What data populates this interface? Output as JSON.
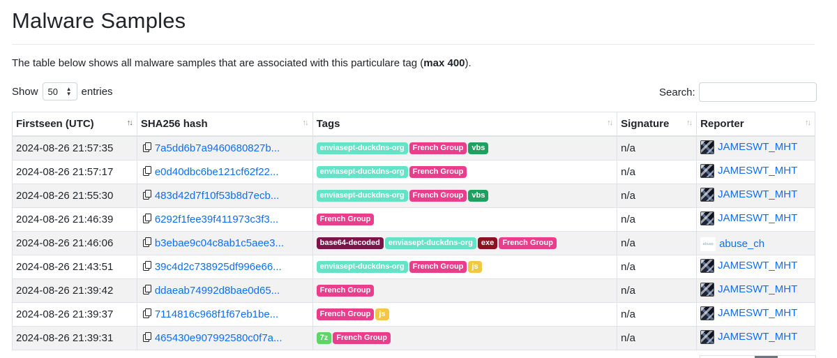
{
  "page": {
    "title": "Malware Samples",
    "intro_text": "The table below shows all malware samples that are associated with this particulare tag (",
    "intro_bold": "max 400",
    "intro_end": ")."
  },
  "length_menu": {
    "show_label": "Show",
    "selected": "50",
    "entries_label": "entries"
  },
  "search": {
    "label": "Search:",
    "value": ""
  },
  "table": {
    "columns": [
      "Firstseen (UTC)",
      "SHA256 hash",
      "Tags",
      "Signature",
      "Reporter"
    ],
    "rows": [
      {
        "firstseen": "2024-08-26 21:57:35",
        "hash": "7a5dd6b7a9460680827b...",
        "tags": [
          {
            "label": "enviasept-duckdns-org",
            "color": "#64e3c6"
          },
          {
            "label": "French Group",
            "color": "#e83e8c"
          },
          {
            "label": "vbs",
            "color": "#1fa05f"
          }
        ],
        "signature": "n/a",
        "reporter": "JAMESWT_MHT",
        "avatar": "photo"
      },
      {
        "firstseen": "2024-08-26 21:57:17",
        "hash": "e0d40dbc6be121cf62f22...",
        "tags": [
          {
            "label": "enviasept-duckdns-org",
            "color": "#64e3c6"
          },
          {
            "label": "French Group",
            "color": "#e83e8c"
          }
        ],
        "signature": "n/a",
        "reporter": "JAMESWT_MHT",
        "avatar": "photo"
      },
      {
        "firstseen": "2024-08-26 21:55:30",
        "hash": "483d42d7f10f53b8d7ecb...",
        "tags": [
          {
            "label": "enviasept-duckdns-org",
            "color": "#64e3c6"
          },
          {
            "label": "French Group",
            "color": "#e83e8c"
          },
          {
            "label": "vbs",
            "color": "#1fa05f"
          }
        ],
        "signature": "n/a",
        "reporter": "JAMESWT_MHT",
        "avatar": "photo"
      },
      {
        "firstseen": "2024-08-26 21:46:39",
        "hash": "6292f1fee39f411973c3f3...",
        "tags": [
          {
            "label": "French Group",
            "color": "#e83e8c"
          }
        ],
        "signature": "n/a",
        "reporter": "JAMESWT_MHT",
        "avatar": "photo"
      },
      {
        "firstseen": "2024-08-26 21:46:06",
        "hash": "b3ebae9c04c8ab1c5aee3...",
        "tags": [
          {
            "label": "base64-decoded",
            "color": "#7a1449"
          },
          {
            "label": "enviasept-duckdns-org",
            "color": "#64e3c6"
          },
          {
            "label": "exe",
            "color": "#8b1221"
          },
          {
            "label": "French Group",
            "color": "#e83e8c"
          }
        ],
        "signature": "n/a",
        "reporter": "abuse_ch",
        "avatar": "abuse"
      },
      {
        "firstseen": "2024-08-26 21:43:51",
        "hash": "39c4d2c738925df996e66...",
        "tags": [
          {
            "label": "enviasept-duckdns-org",
            "color": "#64e3c6"
          },
          {
            "label": "French Group",
            "color": "#e83e8c"
          },
          {
            "label": "js",
            "color": "#f2c744"
          }
        ],
        "signature": "n/a",
        "reporter": "JAMESWT_MHT",
        "avatar": "photo"
      },
      {
        "firstseen": "2024-08-26 21:39:42",
        "hash": "ddaeab74992d8bae0d65...",
        "tags": [
          {
            "label": "French Group",
            "color": "#e83e8c"
          }
        ],
        "signature": "n/a",
        "reporter": "JAMESWT_MHT",
        "avatar": "photo"
      },
      {
        "firstseen": "2024-08-26 21:39:37",
        "hash": "7114816c968f1f67eb1be...",
        "tags": [
          {
            "label": "French Group",
            "color": "#e83e8c"
          },
          {
            "label": "js",
            "color": "#f2c744"
          }
        ],
        "signature": "n/a",
        "reporter": "JAMESWT_MHT",
        "avatar": "photo"
      },
      {
        "firstseen": "2024-08-26 21:39:31",
        "hash": "465430e907992580c0f7a...",
        "tags": [
          {
            "label": "7z",
            "color": "#5fd46a"
          },
          {
            "label": "French Group",
            "color": "#e83e8c"
          }
        ],
        "signature": "n/a",
        "reporter": "JAMESWT_MHT",
        "avatar": "photo"
      }
    ]
  }
}
